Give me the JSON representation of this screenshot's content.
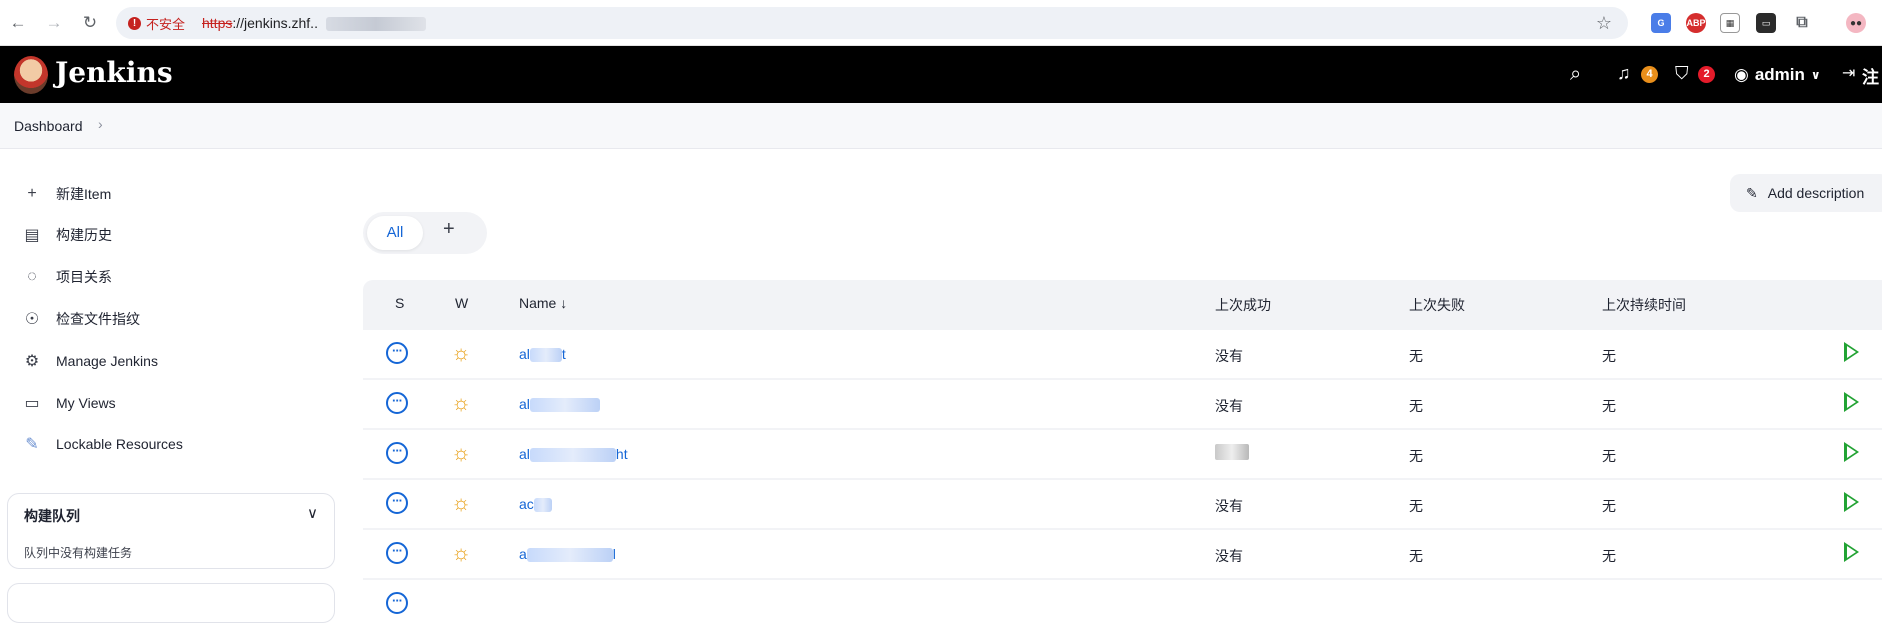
{
  "browser": {
    "security_label": "不安全",
    "url_scheme": "https",
    "url_rest": "://jenkins.zhf.."
  },
  "header": {
    "brand": "Jenkins",
    "notifications_count": "4",
    "security_count": "2",
    "user": "admin",
    "logout_label": "注"
  },
  "breadcrumb": {
    "dashboard": "Dashboard"
  },
  "sidebar": {
    "items": [
      {
        "label": "新建Item",
        "icon": "plus-icon"
      },
      {
        "label": "构建历史",
        "icon": "inbox-icon"
      },
      {
        "label": "项目关系",
        "icon": "relationship-icon"
      },
      {
        "label": "检查文件指纹",
        "icon": "fingerprint-icon"
      },
      {
        "label": "Manage Jenkins",
        "icon": "gear-icon"
      },
      {
        "label": "My Views",
        "icon": "window-icon"
      },
      {
        "label": "Lockable Resources",
        "icon": "lock-resource-icon"
      }
    ],
    "queue_title": "构建队列",
    "queue_empty": "队列中没有构建任务"
  },
  "main": {
    "add_description": "Add description",
    "tab_all": "All",
    "tab_add": "+",
    "columns": {
      "s": "S",
      "w": "W",
      "name": "Name",
      "sort_arrow": "↓",
      "last_success": "上次成功",
      "last_failure": "上次失败",
      "last_duration": "上次持续时间"
    },
    "rows": [
      {
        "name_prefix": "al",
        "name_suffix": "t",
        "last_success": "没有",
        "last_failure": "无",
        "last_duration": "无"
      },
      {
        "name_prefix": "al",
        "name_suffix": "",
        "last_success": "没有",
        "last_failure": "无",
        "last_duration": "无"
      },
      {
        "name_prefix": "al",
        "name_suffix": "ht",
        "last_success": "",
        "last_failure": "无",
        "last_duration": "无"
      },
      {
        "name_prefix": "ac",
        "name_suffix": "",
        "last_success": "没有",
        "last_failure": "无",
        "last_duration": "无"
      },
      {
        "name_prefix": "a",
        "name_suffix": "l",
        "last_success": "没有",
        "last_failure": "无",
        "last_duration": "无"
      }
    ]
  },
  "colors": {
    "accent": "#1566d6",
    "play": "#22a334",
    "weather": "#e9a21b",
    "header_bg": "#000000"
  }
}
